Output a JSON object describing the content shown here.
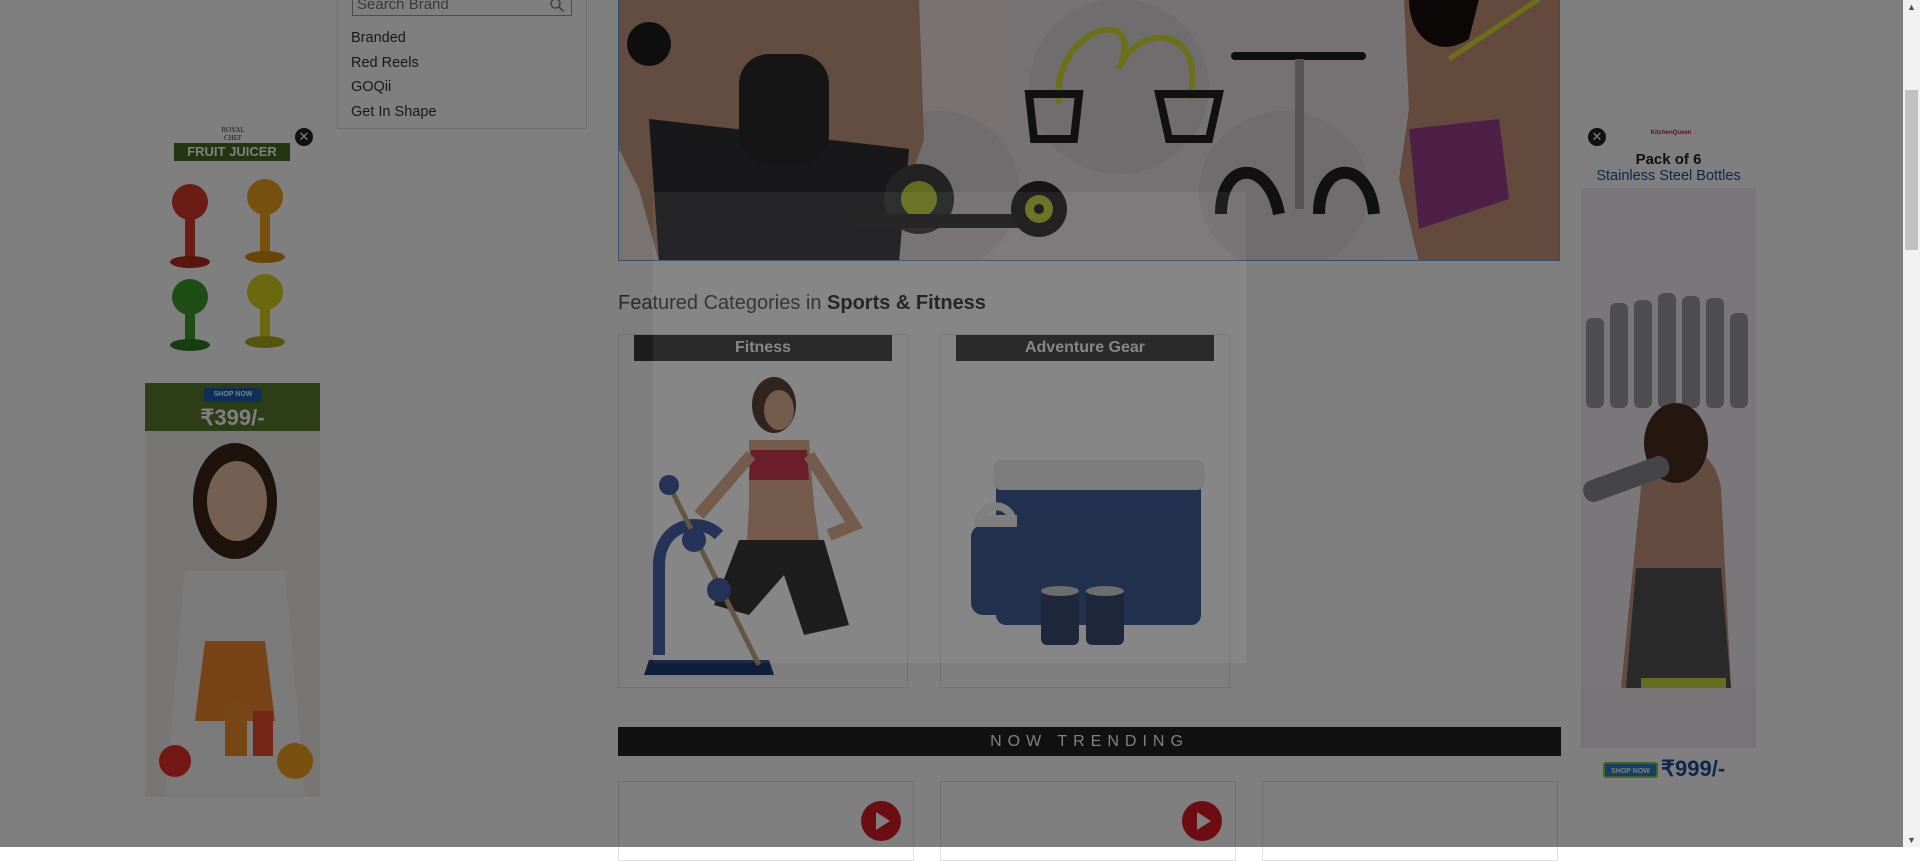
{
  "brand_filter": {
    "search_placeholder": "Search Brand",
    "brands": [
      "Branded",
      "Red Reels",
      "GOQii",
      "Get In Shape"
    ]
  },
  "featured": {
    "prefix": "Featured Categories in ",
    "category": "Sports & Fitness",
    "cards": [
      {
        "label": "Fitness"
      },
      {
        "label": "Adventure Gear"
      }
    ]
  },
  "trending": {
    "label": "NOW TRENDING"
  },
  "ad_left": {
    "brand_line1": "ROYAL",
    "brand_line2": "CHEF",
    "product": "FRUIT JUICER",
    "cta": "SHOP NOW",
    "price": "₹399/-"
  },
  "ad_right": {
    "brand": "KitchenQueen",
    "headline_1": "Pack of 6",
    "headline_2": "Stainless Steel Bottles",
    "cta": "SHOP NOW",
    "price": "₹999/-"
  },
  "close_glyph": "✕",
  "colors": {
    "overlay": "rgba(0,0,0,0.5)",
    "play_button": "#d81b22",
    "trending_bar": "#222222",
    "card_label_bg": "#3a3a3a",
    "left_ad_green": "#4a6b1f",
    "right_ad_blue": "#1a4e9a"
  }
}
